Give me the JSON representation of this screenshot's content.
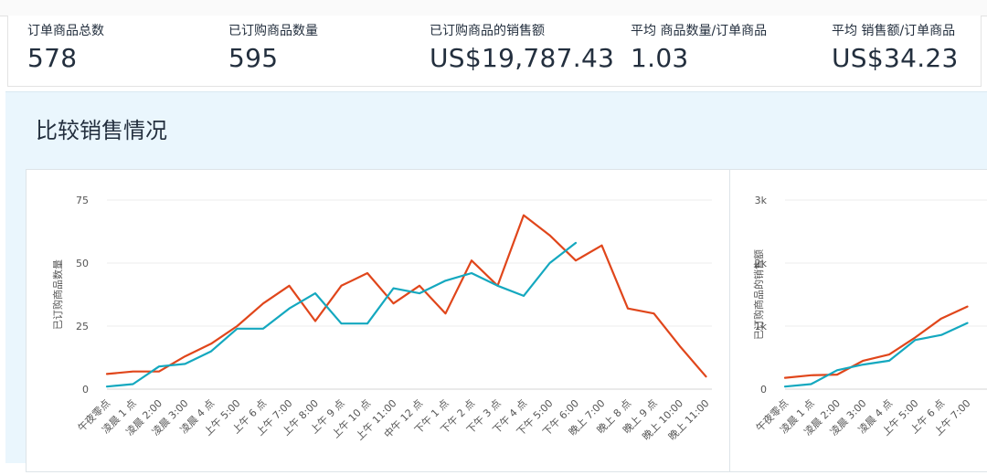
{
  "metrics": [
    {
      "label": "订单商品总数",
      "value": "578"
    },
    {
      "label": "已订购商品数量",
      "value": "595"
    },
    {
      "label": "已订购商品的销售额",
      "value": "US$19,787.43"
    },
    {
      "label": "平均 商品数量/订单商品",
      "value": "1.03"
    },
    {
      "label": "平均 销售额/订单商品",
      "value": "US$34.23"
    }
  ],
  "section": {
    "title": "比较销售情况"
  },
  "colors": {
    "series_a": "#e0461b",
    "series_b": "#14a8bf",
    "grid": "#eeeeee",
    "axis_text": "#555555"
  },
  "chart_data": [
    {
      "type": "line",
      "ylabel": "已订购商品数量",
      "ylim": [
        0,
        75
      ],
      "yticks": [
        0,
        25,
        50,
        75
      ],
      "ytick_labels": [
        "0",
        "25",
        "50",
        "75"
      ],
      "categories": [
        "午夜零点",
        "凌晨 1 点",
        "凌晨 2:00",
        "凌晨 3:00",
        "凌晨 4 点",
        "上午 5:00",
        "上午 6 点",
        "上午 7:00",
        "上午 8:00",
        "上午 9 点",
        "上午 10 点",
        "上午 11:00",
        "中午 12 点",
        "下午 1 点",
        "下午 2 点",
        "下午 3 点",
        "下午 4 点",
        "下午 5:00",
        "下午 6:00",
        "晚上 7:00",
        "晚上 8 点",
        "晚上 9 点",
        "晚上 10:00",
        "晚上 11:00"
      ],
      "grid": true,
      "series": [
        {
          "color": "#e0461b",
          "values": [
            6,
            7,
            7,
            13,
            18,
            25,
            34,
            41,
            27,
            41,
            46,
            34,
            41,
            30,
            51,
            41,
            69,
            61,
            51,
            57,
            32,
            30,
            17,
            5
          ]
        },
        {
          "color": "#14a8bf",
          "values": [
            1,
            2,
            9,
            10,
            15,
            24,
            24,
            32,
            38,
            26,
            26,
            40,
            38,
            43,
            46,
            41,
            37,
            50,
            58
          ]
        }
      ]
    },
    {
      "type": "line",
      "ylabel": "已订购商品的销售额",
      "ylim": [
        0,
        3000
      ],
      "yticks": [
        0,
        1000,
        2000,
        3000
      ],
      "ytick_labels": [
        "0",
        "1k",
        "2k",
        "3k"
      ],
      "categories": [
        "午夜零点",
        "凌晨 1 点",
        "凌晨 2:00",
        "凌晨 3:00",
        "凌晨 4 点",
        "上午 5:00",
        "上午 6 点",
        "上午 7:00"
      ],
      "grid": true,
      "series": [
        {
          "color": "#e0461b",
          "values": [
            180,
            220,
            230,
            450,
            550,
            820,
            1120,
            1310
          ]
        },
        {
          "color": "#14a8bf",
          "values": [
            40,
            80,
            300,
            390,
            450,
            780,
            860,
            1050
          ]
        }
      ]
    }
  ]
}
